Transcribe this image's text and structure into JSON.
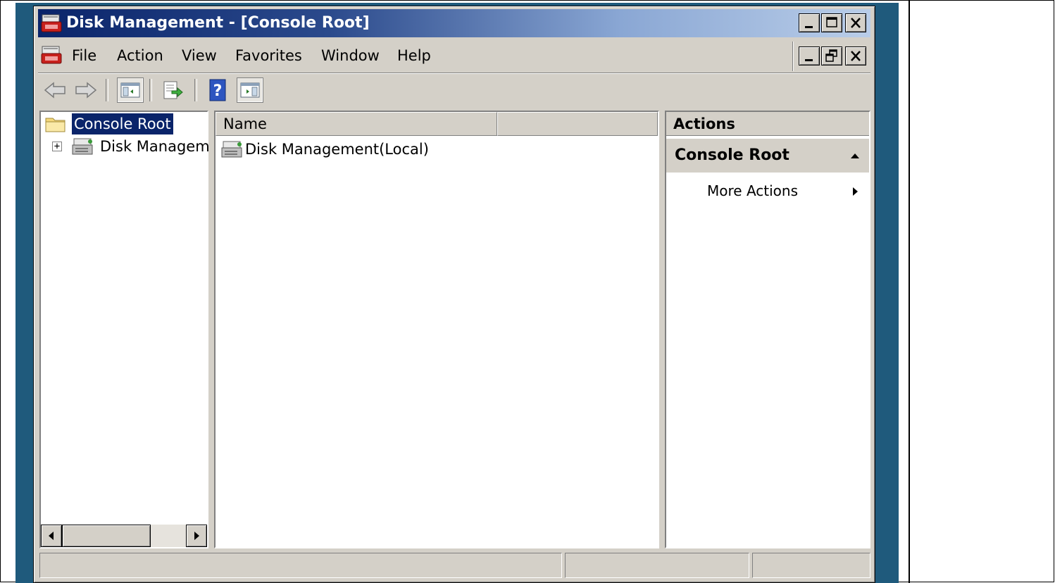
{
  "window": {
    "title": "Disk Management - [Console Root]"
  },
  "menubar": {
    "items": [
      {
        "label": "File"
      },
      {
        "label": "Action"
      },
      {
        "label": "View"
      },
      {
        "label": "Favorites"
      },
      {
        "label": "Window"
      },
      {
        "label": "Help"
      }
    ]
  },
  "toolbar": {
    "buttons": [
      "back-icon",
      "forward-icon",
      "show-hide-console-tree-icon",
      "export-list-icon",
      "help-icon",
      "show-hide-action-pane-icon"
    ]
  },
  "tree": {
    "root_label": "Console Root",
    "child_label": "Disk Manageme",
    "child_expander": "+"
  },
  "list": {
    "column_name": "Name",
    "item_label": "Disk Management(Local)"
  },
  "actions": {
    "header": "Actions",
    "section_title": "Console Root",
    "more_actions_label": "More Actions"
  },
  "colors": {
    "title_active": "#0a246a",
    "selection": "#0a246a",
    "face": "#d4d0c8",
    "desktop": "#1f5a7c"
  }
}
